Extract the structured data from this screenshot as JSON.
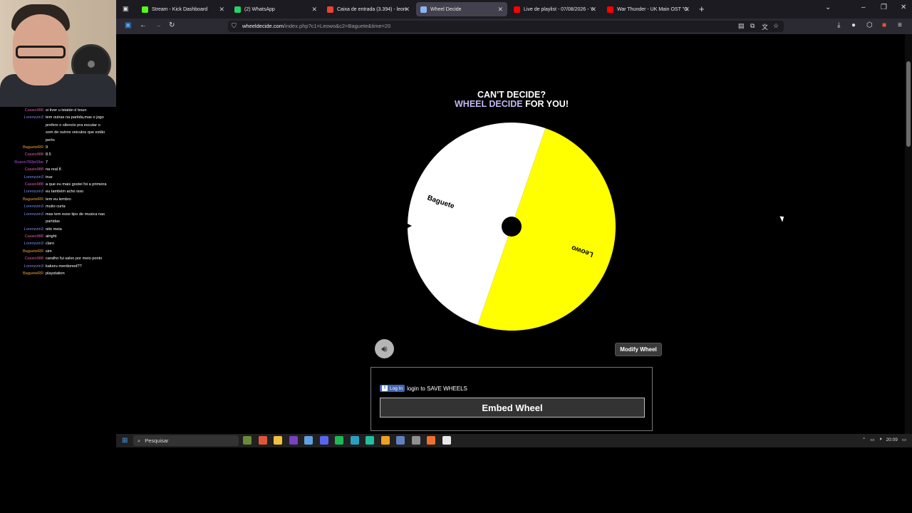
{
  "chat": {
    "messages": [
      {
        "user": "Cassio988",
        "user_color": "#e05aa8",
        "lines": [
          "si tiver u lstatán é boun"
        ]
      },
      {
        "user": "Lorenzzin3",
        "user_color": "#7e8cf0",
        "lines": [
          "tem outras na partida,mas o jogo",
          "prefere o silencio pra escutar o",
          "som de outros veiculos que estão",
          "perto"
        ]
      },
      {
        "user": "BagueteRR",
        "user_color": "#f0a030",
        "lines": [
          "9"
        ]
      },
      {
        "user": "Cassio988",
        "user_color": "#e05aa8",
        "lines": [
          "8.5"
        ]
      },
      {
        "user": "Ruann782jel2be",
        "user_color": "#b050e0",
        "lines": [
          "7"
        ]
      },
      {
        "user": "Cassio988",
        "user_color": "#e05aa8",
        "lines": [
          "na real 8"
        ]
      },
      {
        "user": "Lorenzzin3",
        "user_color": "#7e8cf0",
        "lines": [
          "true"
        ]
      },
      {
        "user": "Cassio988",
        "user_color": "#e05aa8",
        "lines": [
          "a que eu mais gostei foi a primeira"
        ]
      },
      {
        "user": "Lorenzzin3",
        "user_color": "#7e8cf0",
        "lines": [
          "eu também acho isso"
        ]
      },
      {
        "user": "BagueteRR",
        "user_color": "#f0a030",
        "lines": [
          "tem eu lembro"
        ]
      },
      {
        "user": "Lorenzzin3",
        "user_color": "#7e8cf0",
        "lines": [
          "muito curta"
        ]
      },
      {
        "user": "Lorenzzin3",
        "user_color": "#7e8cf0",
        "lines": [
          "mas tem esse tipo de musica nas",
          "partidas"
        ]
      },
      {
        "user": "Lorenzzin3",
        "user_color": "#7e8cf0",
        "lines": [
          "oito meia"
        ]
      },
      {
        "user": "Cassio988",
        "user_color": "#e05aa8",
        "lines": [
          "alright"
        ]
      },
      {
        "user": "Lorenzzin3",
        "user_color": "#7e8cf0",
        "lines": [
          "claro"
        ]
      },
      {
        "user": "BagueteRR",
        "user_color": "#f0a030",
        "lines": [
          "sim"
        ]
      },
      {
        "user": "Cassio988",
        "user_color": "#e05aa8",
        "lines": [
          "caralho fui salvo por meio ponto"
        ]
      },
      {
        "user": "Lorenzzin3",
        "user_color": "#7e8cf0",
        "lines": [
          "kakeru mentioned??"
        ]
      },
      {
        "user": "BagueteRR",
        "user_color": "#f0a030",
        "lines": [
          "playstation"
        ]
      }
    ]
  },
  "tabs": [
    {
      "label": "Stream - Kick Dashboard",
      "color": "#53fc18",
      "active": false
    },
    {
      "label": "(2) WhatsApp",
      "color": "#25d366",
      "active": false
    },
    {
      "label": "Caixa de entrada (3.394) - leon",
      "color": "#ea4335",
      "active": false
    },
    {
      "label": "Wheel Decide",
      "color": "#8ab4f8",
      "active": true
    },
    {
      "label": "Live de playlist - 07/08/2026 - Y",
      "color": "#ff0000",
      "active": false
    },
    {
      "label": "War Thunder - UK Main OST \"C",
      "color": "#ff0000",
      "active": false
    }
  ],
  "url": {
    "host": "wheeldecide.com",
    "path": "/index.php?c1=Leowo&c2=Baguete&time=20"
  },
  "page": {
    "headline_line1": "CAN'T DECIDE?",
    "headline_brand": "WHEEL DECIDE",
    "headline_rest": " FOR YOU!",
    "modify_label": "Modify Wheel",
    "fb_login_label": "Log In",
    "save_text": "login to SAVE WHEELS",
    "embed_label": "Embed Wheel"
  },
  "wheel": {
    "segments": [
      {
        "label": "Leowo",
        "color": "#ffff00"
      },
      {
        "label": "Baguete",
        "color": "#ffffff"
      }
    ],
    "hub_color": "#000000"
  },
  "taskbar": {
    "search_placeholder": "Pesquisar",
    "time": "20:09",
    "app_colors": [
      "#6b8a3a",
      "#e0563a",
      "#f0c040",
      "#7a40c0",
      "#60a0e0",
      "#5865f2",
      "#1db954",
      "#2aa0c0",
      "#20c0a0",
      "#f0a020",
      "#6080c0",
      "#909090",
      "#f07030",
      "#e8e8e8"
    ]
  }
}
